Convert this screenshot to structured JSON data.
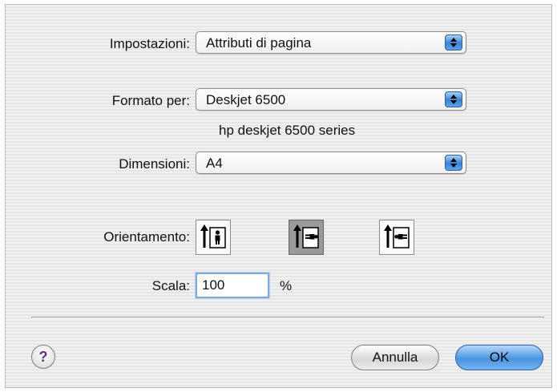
{
  "settings": {
    "label": "Impostazioni:",
    "value": "Attributi di pagina"
  },
  "format_for": {
    "label": "Formato per:",
    "value": "Deskjet 6500",
    "description": "hp deskjet 6500 series"
  },
  "paper_size": {
    "label": "Dimensioni:",
    "value": "A4"
  },
  "orientation": {
    "label": "Orientamento:",
    "options": [
      "portrait",
      "landscape-left",
      "landscape-right"
    ],
    "selected": "landscape-left"
  },
  "scale": {
    "label": "Scala:",
    "value": "100",
    "unit": "%"
  },
  "help": {
    "symbol": "?"
  },
  "buttons": {
    "cancel_label": "Annulla",
    "ok_label": "OK"
  },
  "colors": {
    "accent": "#3b82d2",
    "selected_orientation": "#9a9a9a"
  },
  "icons": {
    "popup_arrows": "up-down-arrows-icon",
    "orientation_portrait": "portrait-person-icon",
    "orientation_landscape_left": "landscape-left-person-icon",
    "orientation_landscape_right": "landscape-right-person-icon"
  }
}
